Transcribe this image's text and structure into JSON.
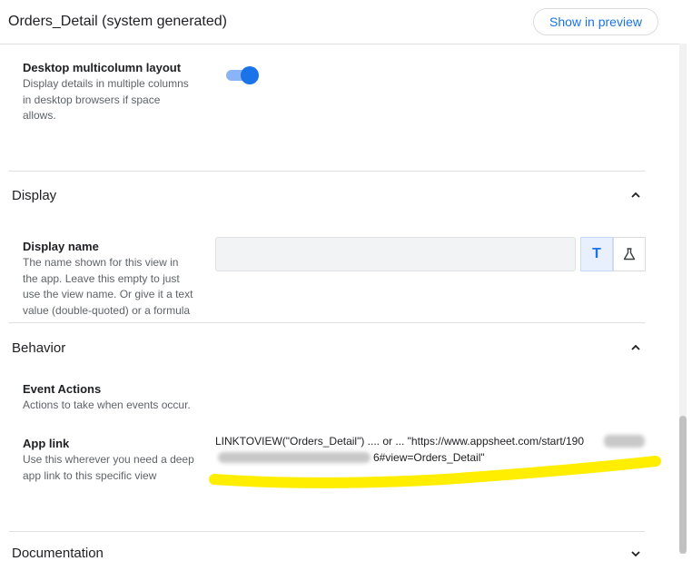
{
  "header": {
    "title": "Orders_Detail (system generated)",
    "show_preview_label": "Show in preview"
  },
  "desktop_multicolumn": {
    "label": "Desktop multicolumn layout",
    "desc_lines": [
      "Display details in multiple columns",
      "in desktop browsers if space",
      "allows."
    ],
    "enabled": true
  },
  "display_section": {
    "title": "Display",
    "display_name": {
      "label": "Display name",
      "desc_lines": [
        "The name shown for this view in",
        "the app. Leave this empty to just",
        "use the view name. Or give it a text",
        "value (double-quoted) or a formula"
      ],
      "value": "",
      "text_mode_glyph": "T"
    }
  },
  "behavior_section": {
    "title": "Behavior",
    "event_actions": {
      "label": "Event Actions",
      "desc": "Actions to take when events occur."
    },
    "app_link": {
      "label": "App link",
      "desc_lines": [
        "Use this wherever you need a deep",
        "app link to this specific view"
      ],
      "value_line1": "LINKTOVIEW(\"Orders_Detail\") .... or ... \"https://www.appsheet.com/start/190",
      "value_line2_end": "6#view=Orders_Detail\""
    }
  },
  "documentation_section": {
    "title": "Documentation"
  },
  "colors": {
    "accent": "#1a73e8",
    "highlight": "#ffee00"
  },
  "icons": {
    "collapse": "chevron-up-icon",
    "expand": "chevron-down-icon",
    "formula": "flask-icon"
  }
}
